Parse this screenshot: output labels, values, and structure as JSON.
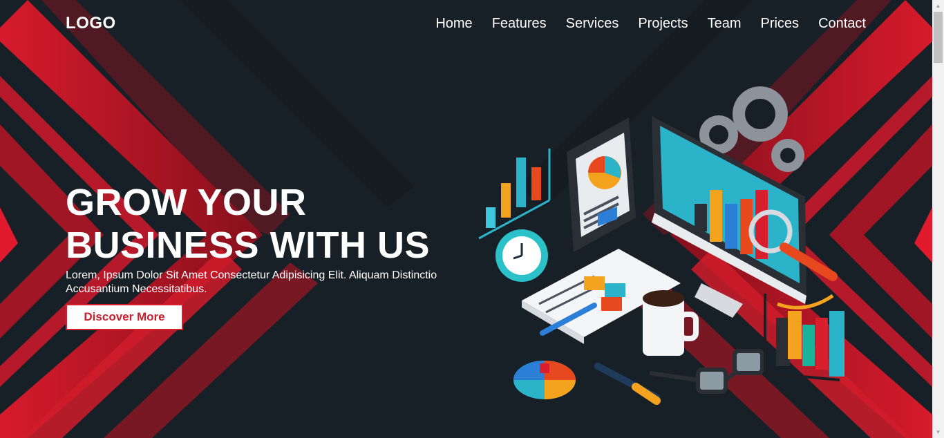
{
  "header": {
    "logo": "LOGO",
    "nav": [
      "Home",
      "Features",
      "Services",
      "Projects",
      "Team",
      "Prices",
      "Contact"
    ]
  },
  "hero": {
    "headline_line1": "GROW YOUR",
    "headline_line2": "BUSINESS WITH US",
    "subtitle": "Lorem, Ipsum Dolor Sit Amet Consectetur Adipisicing Elit. Aliquam Distinctio Accusantium Necessitatibus.",
    "cta_label": "Discover More"
  },
  "icons": {
    "illustration": "business-analytics-illustration",
    "scroll_up": "arrow-up-icon",
    "scroll_down": "arrow-down-icon"
  },
  "colors": {
    "background": "#182027",
    "accent_red": "#d61f2c",
    "text": "#ffffff"
  }
}
